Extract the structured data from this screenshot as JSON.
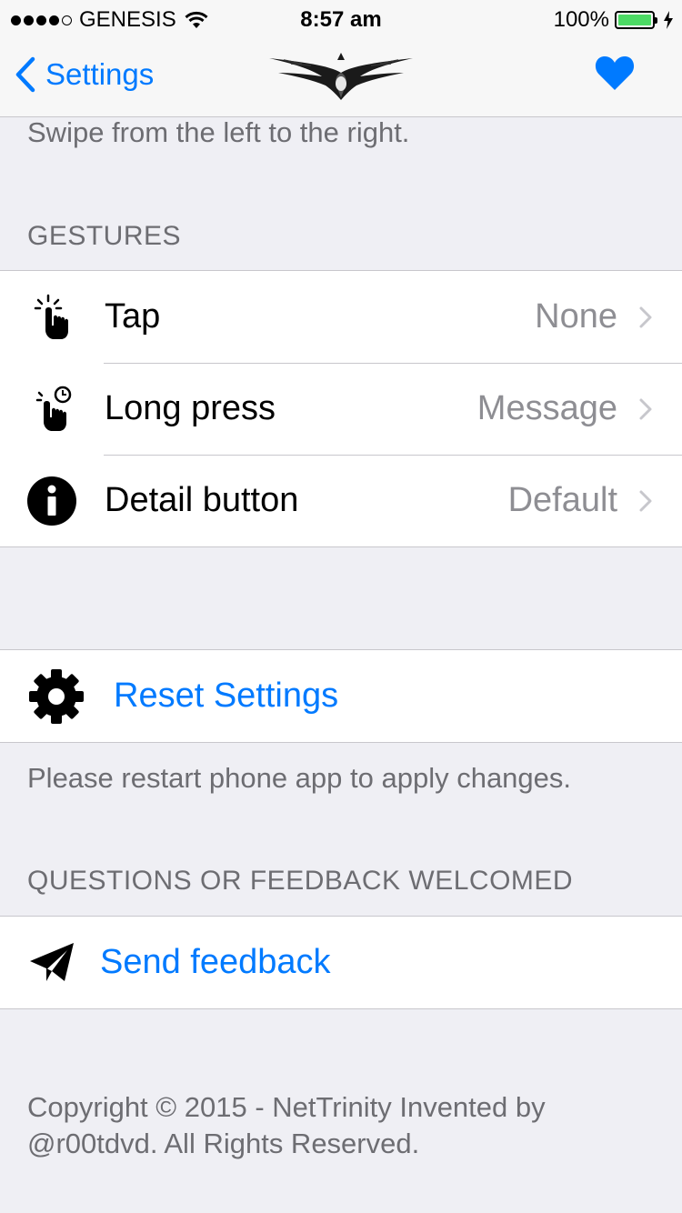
{
  "status_bar": {
    "carrier": "GENESIS",
    "time": "8:57 am",
    "battery": "100%"
  },
  "nav": {
    "back_label": "Settings"
  },
  "top_text": "Swipe from the left to the right.",
  "gestures": {
    "header": "GESTURES",
    "rows": [
      {
        "label": "Tap",
        "value": "None"
      },
      {
        "label": "Long press",
        "value": "Message"
      },
      {
        "label": "Detail button",
        "value": "Default"
      }
    ]
  },
  "reset": {
    "label": "Reset Settings",
    "footer": "Please restart phone app to apply changes."
  },
  "feedback": {
    "header": "QUESTIONS OR FEEDBACK WELCOMED",
    "label": "Send feedback"
  },
  "copyright": {
    "line1": "Copyright © 2015 - NetTrinity Invented by",
    "line2": "@r00tdvd. All Rights Reserved."
  },
  "colors": {
    "accent": "#007aff",
    "background": "#efeff4",
    "battery": "#4cd964"
  }
}
